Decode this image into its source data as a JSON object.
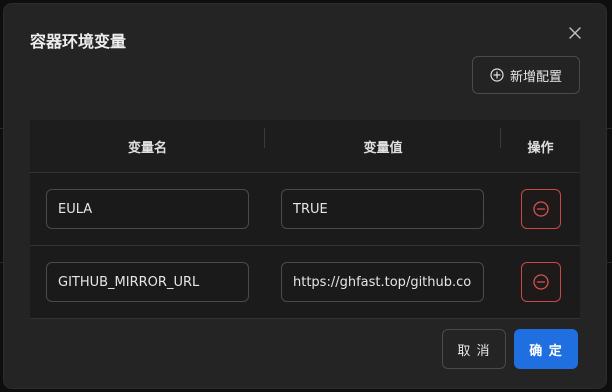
{
  "dialog": {
    "title": "容器环境变量",
    "add_button_label": "新增配置",
    "cancel_label": "取 消",
    "confirm_label": "确 定"
  },
  "table": {
    "headers": {
      "name": "变量名",
      "value": "变量值",
      "actions": "操作"
    },
    "rows": [
      {
        "name": "EULA",
        "value": "TRUE"
      },
      {
        "name": "GITHUB_MIRROR_URL",
        "value": "https://ghfast.top/github.com"
      }
    ]
  },
  "colors": {
    "primary": "#1f6fe0",
    "danger": "#c94848",
    "surface": "#242424"
  }
}
